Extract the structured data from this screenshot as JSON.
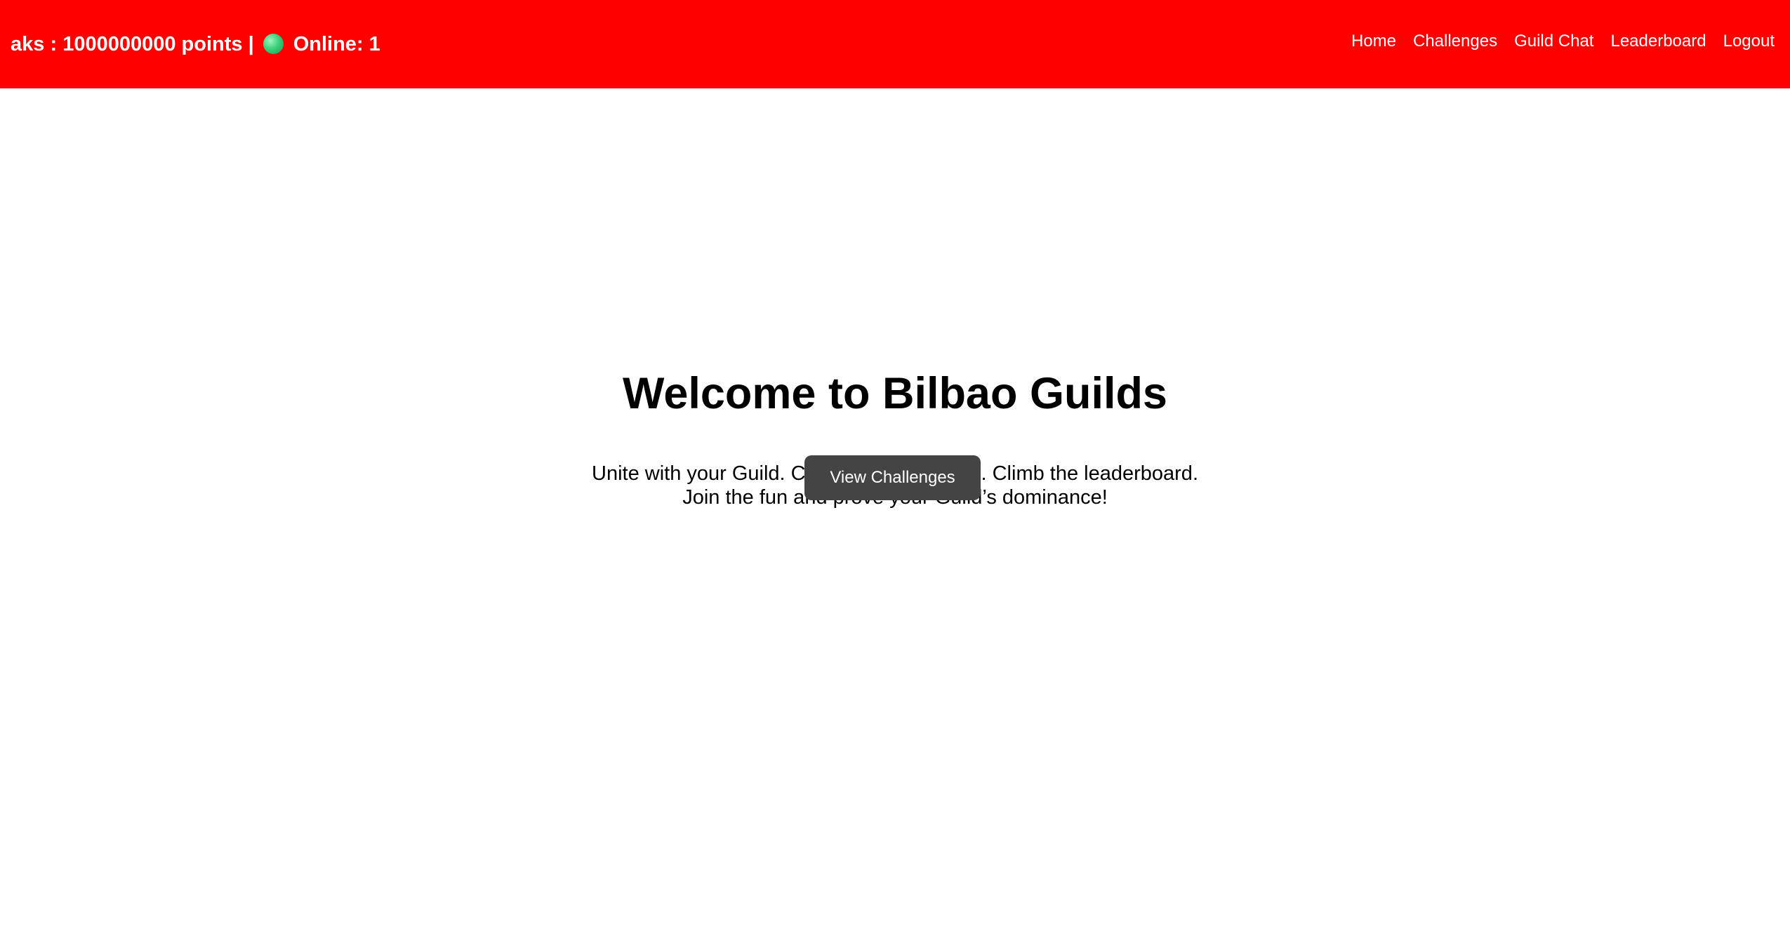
{
  "header": {
    "username": "aks",
    "separator": ":",
    "points": "1000000000 points",
    "divider": "|",
    "online_label": "Online: 1",
    "status_color": "#3ad17a",
    "background_color": "#ff0000"
  },
  "nav": {
    "items": [
      {
        "label": "Home"
      },
      {
        "label": "Challenges"
      },
      {
        "label": "Guild Chat"
      },
      {
        "label": "Leaderboard"
      },
      {
        "label": "Logout"
      }
    ]
  },
  "hero": {
    "title": "Welcome to Bilbao Guilds",
    "tagline_line1": "Unite with your Guild. Complete challenges. Climb the leaderboard.",
    "tagline_line2": "Join the fun and prove your Guild’s dominance!",
    "cta_label": "View Challenges",
    "cta_color": "#444444"
  }
}
